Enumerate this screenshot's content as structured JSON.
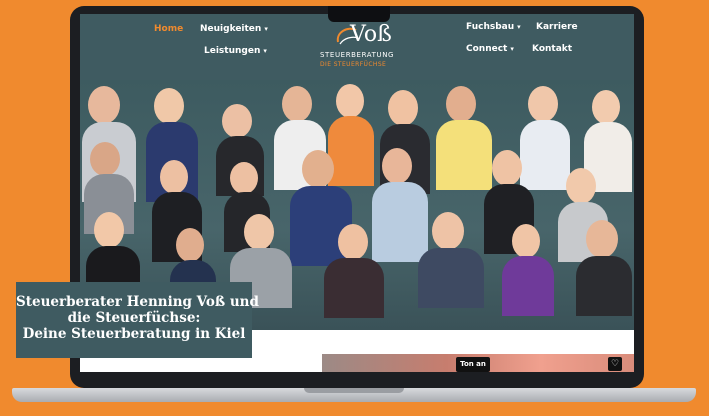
{
  "nav": {
    "home": "Home",
    "news": "Neuigkeiten",
    "services": "Leistungen",
    "fuchsbau": "Fuchsbau",
    "career": "Karriere",
    "connect": "Connect",
    "contact": "Kontakt"
  },
  "logo": {
    "mark": "Voß",
    "name": "STEUERBERATUNG",
    "sub": "DIE STEUERFÜCHSE"
  },
  "hero": {
    "title_line1": "Steuerberater Henning Voß und",
    "title_line2": "die Steuerfüchse:",
    "title_line3": "Deine Steuerberatung in Kiel"
  },
  "video": {
    "sound_label": "Ton an",
    "heart_icon": "heart-icon"
  },
  "colors": {
    "background": "#f08a2e",
    "header": "#3f5b61",
    "accent": "#f08a2e"
  }
}
